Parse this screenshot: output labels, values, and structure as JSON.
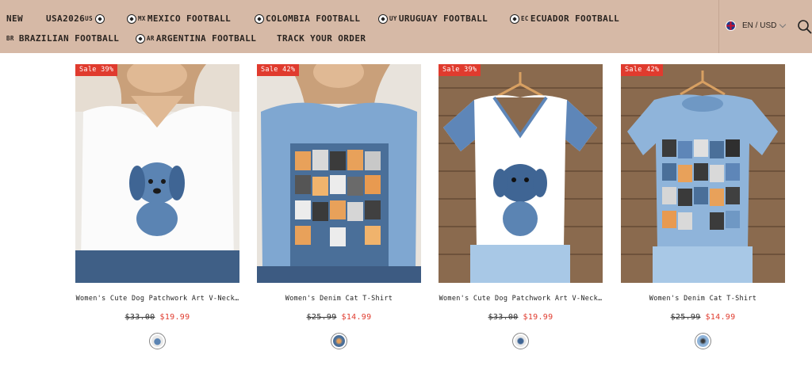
{
  "nav": {
    "items": [
      {
        "label": "NEW"
      },
      {
        "label": "USA2026",
        "suffix": "US"
      },
      {
        "code": "MX",
        "label": "MEXICO FOOTBALL"
      },
      {
        "label": "COLOMBIA FOOTBALL"
      },
      {
        "code": "UY",
        "label": "URUGUAY FOOTBALL"
      },
      {
        "code": "EC",
        "label": "ECUADOR FOOTBALL"
      },
      {
        "code": "BR",
        "label": "BRAZILIAN FOOTBALL"
      },
      {
        "code": "AR",
        "label": "ARGENTINA FOOTBALL"
      },
      {
        "label": "TRACK YOUR ORDER"
      }
    ],
    "locale": "EN / USD"
  },
  "products": [
    {
      "badge": "Sale 39%",
      "name": "Women's Cute Dog Patchwork Art V-Neck…",
      "old_price": "$33.00",
      "price": "$19.99"
    },
    {
      "badge": "Sale 42%",
      "name": "Women's Denim Cat T-Shirt",
      "old_price": "$25.99",
      "price": "$14.99"
    },
    {
      "badge": "Sale 39%",
      "name": "Women's Cute Dog Patchwork Art V-Neck…",
      "old_price": "$33.00",
      "price": "$19.99"
    },
    {
      "badge": "Sale 42%",
      "name": "Women's Denim Cat T-Shirt",
      "old_price": "$25.99",
      "price": "$14.99"
    }
  ],
  "colors": {
    "header_bg": "#d6b9a6",
    "sale_red": "#e03b2e"
  }
}
